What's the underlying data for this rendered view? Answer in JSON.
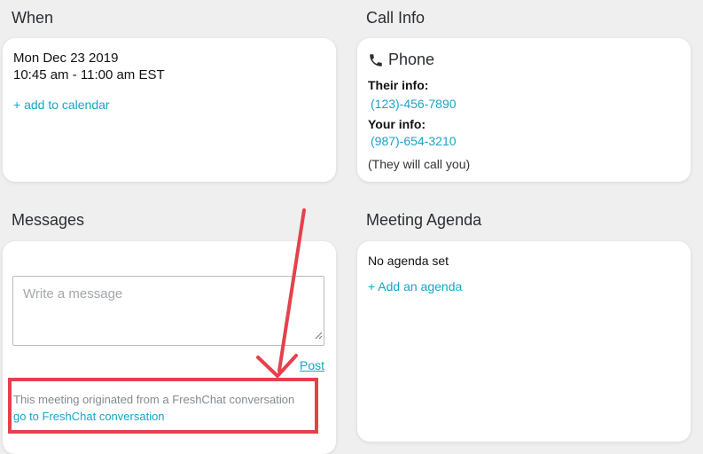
{
  "when": {
    "title": "When",
    "date": "Mon Dec 23 2019",
    "time": "10:45 am - 11:00 am EST",
    "add_to_calendar": "+ add to calendar"
  },
  "call_info": {
    "title": "Call Info",
    "method": "Phone",
    "method_icon": "phone-icon",
    "their_label": "Their info:",
    "their_phone": "(123)-456-7890",
    "your_label": "Your info:",
    "your_phone": "(987)-654-3210",
    "note": "(They will call you)"
  },
  "messages": {
    "title": "Messages",
    "placeholder": "Write a message",
    "post_label": "Post",
    "origin_text": "This meeting originated from a FreshChat conversation",
    "origin_link": "go to FreshChat conversation"
  },
  "agenda": {
    "title": "Meeting Agenda",
    "empty_text": "No agenda set",
    "add_link": "+ Add an agenda"
  },
  "colors": {
    "accent": "#1aa3c9",
    "annotation": "#e5414c",
    "background": "#efeff0"
  }
}
